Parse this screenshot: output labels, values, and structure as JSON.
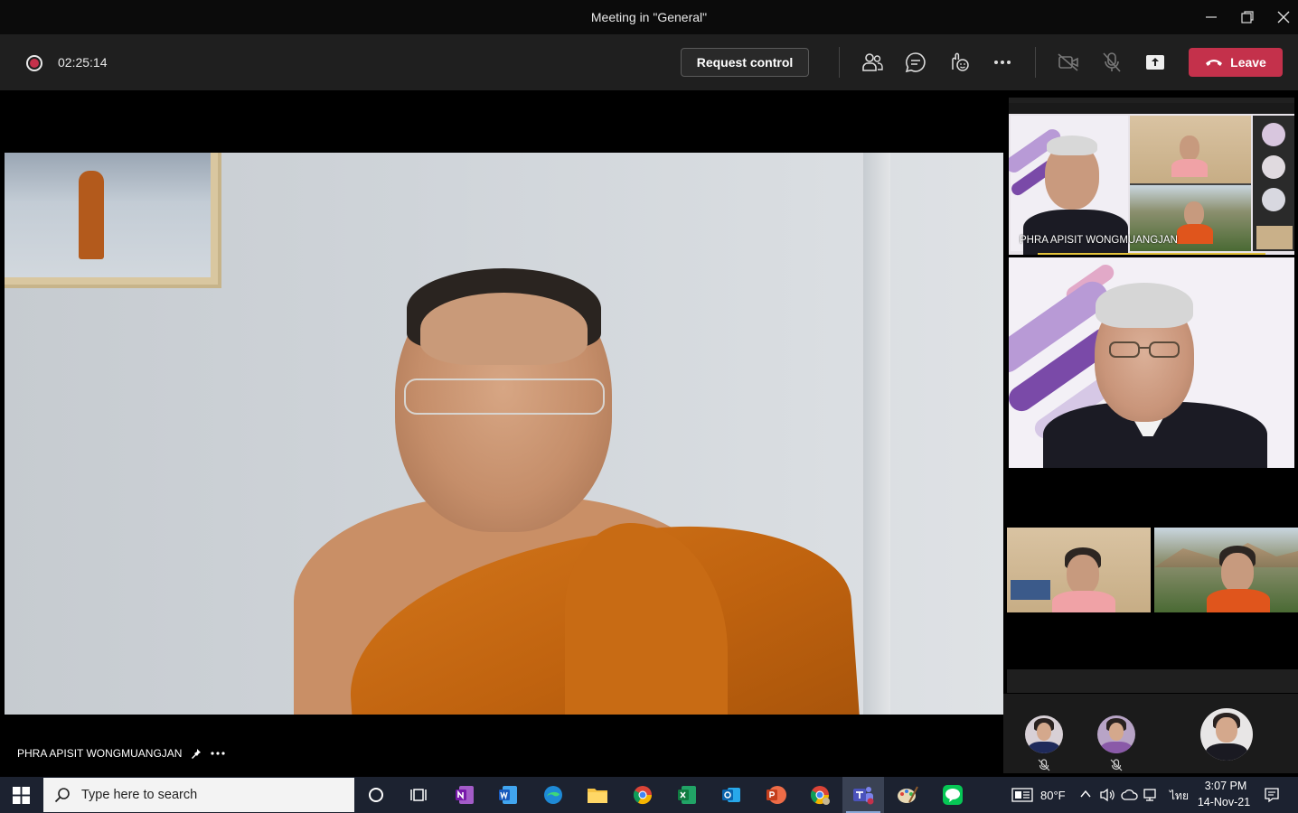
{
  "window": {
    "title": "Meeting in \"General\""
  },
  "meeting_bar": {
    "timer": "02:25:14",
    "request_control_label": "Request control",
    "leave_label": "Leave",
    "icons": [
      "participants-icon",
      "chat-icon",
      "reactions-icon",
      "more-actions-icon",
      "camera-off-icon",
      "mic-off-icon",
      "share-tray-icon",
      "phone-hangup-icon"
    ]
  },
  "main_stage": {
    "participant_name": "PHRA APISIT WONGMUANGJAN",
    "icons": [
      "pin-icon",
      "more-options-icon"
    ]
  },
  "right_rail": {
    "shared_screen_name": "PHRA APISIT WONGMUANGJAN",
    "audience_count": 3
  },
  "taskbar": {
    "search_placeholder": "Type here to search",
    "weather": "80°F",
    "language": "ไทย",
    "time": "3:07 PM",
    "date": "14-Nov-21",
    "apps": [
      "cortana-icon",
      "task-view-icon",
      "onenote-icon",
      "word-icon",
      "edge-icon",
      "file-explorer-icon",
      "chrome-icon",
      "excel-icon",
      "outlook-icon",
      "powerpoint-icon",
      "chrome-profile-icon",
      "teams-icon",
      "paint-icon",
      "line-icon"
    ]
  },
  "colors": {
    "leave_red": "#c4314b",
    "record_red": "#c4314b",
    "meeting_bar_bg": "#1f1f1f",
    "taskbar_bg": "#1c2230"
  }
}
